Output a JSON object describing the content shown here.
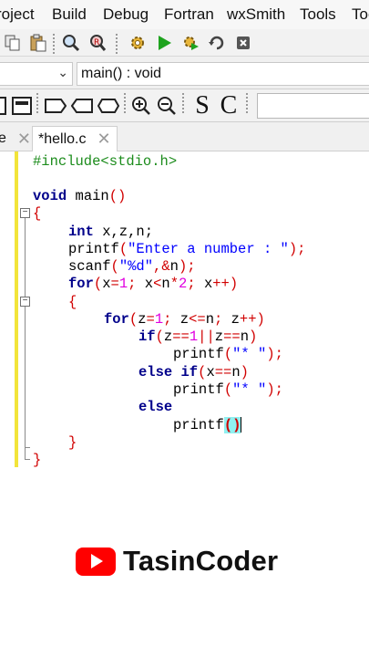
{
  "menubar": {
    "items": [
      "roject",
      "Build",
      "Debug",
      "Fortran",
      "wxSmith",
      "Tools",
      "Too"
    ]
  },
  "toolbar2": {
    "function_combo": "main() : void",
    "combo_arrow": "⌄"
  },
  "toolbar3": {
    "select_label": "S",
    "cursor_label": "C"
  },
  "tabs": [
    {
      "label": "e",
      "close": "✕"
    },
    {
      "label": "*hello.c",
      "close": "✕"
    }
  ],
  "code": {
    "include": "#include<stdio.h>",
    "main_decl": [
      "void",
      " main",
      "()"
    ],
    "open_main": "{",
    "decl": [
      "int",
      " x,z,n;"
    ],
    "printf1": [
      "printf",
      "(",
      "\"Enter a number : \"",
      ");"
    ],
    "scanf": [
      "scanf",
      "(",
      "\"%d\"",
      ",",
      "&",
      "n",
      ");"
    ],
    "for1": [
      "for",
      "(",
      "x",
      "=",
      "1",
      ";",
      " x",
      "<",
      "n",
      "*",
      "2",
      ";",
      " x",
      "++",
      ")"
    ],
    "open_for1": "{",
    "for2": [
      "for",
      "(",
      "z",
      "=",
      "1",
      ";",
      " z",
      "<=",
      "n",
      ";",
      " z",
      "++",
      ")"
    ],
    "if1": [
      "if",
      "(",
      "z",
      "==",
      "1",
      "||",
      "z",
      "==",
      "n",
      ")"
    ],
    "printf2": [
      "printf",
      "(",
      "\"* \"",
      ");"
    ],
    "elseif": [
      "else if",
      "(",
      "x",
      "==",
      "n",
      ")"
    ],
    "printf3": [
      "printf",
      "(",
      "\"* \"",
      ");"
    ],
    "else": "else",
    "printf4": [
      "printf",
      "()"
    ],
    "close_for1": "}",
    "close_main": "}"
  },
  "watermark": {
    "text": "TasinCoder"
  },
  "colors": {
    "preprocessor": "#1c8c1c",
    "keyword": "#00008b",
    "operator": "#d10000",
    "string": "#0000ff",
    "number": "#e000e0",
    "brace_highlight": "#8ff0f0",
    "modified_bar": "#f2e43a",
    "youtube_red": "#ff0000"
  },
  "icons": [
    "copy-icon",
    "paste-icon",
    "find-icon",
    "replace-icon",
    "build-gear-icon",
    "run-icon",
    "build-run-icon",
    "rebuild-icon",
    "abort-icon",
    "block-comment-icon",
    "zoom-in-icon",
    "zoom-out-icon",
    "youtube-logo-icon"
  ]
}
